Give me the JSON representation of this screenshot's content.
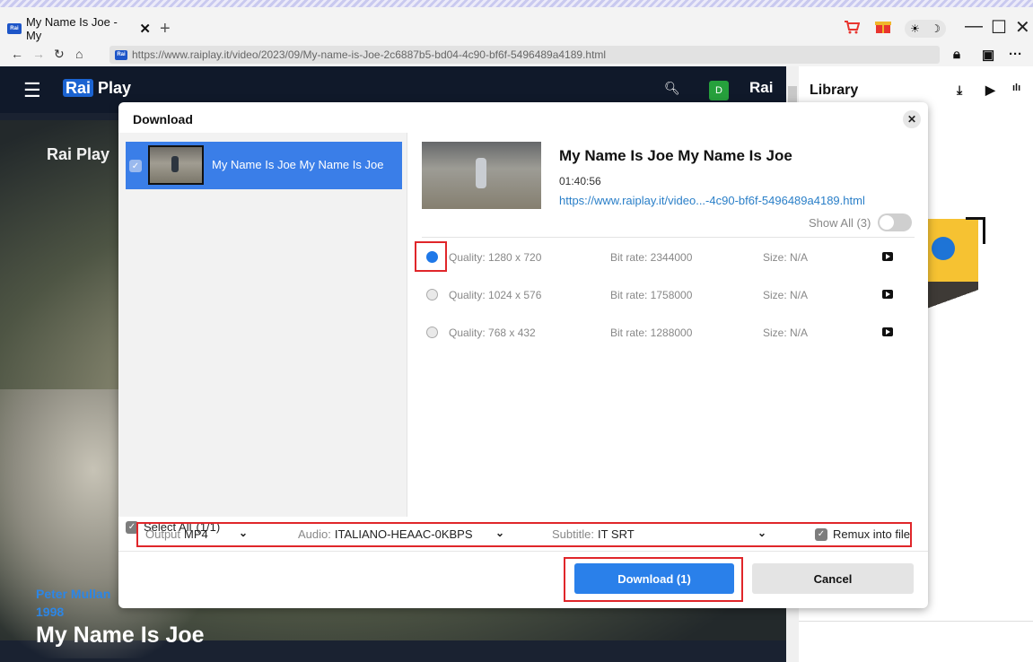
{
  "browser": {
    "tab_title": "My Name Is Joe - My",
    "tab_close": "✕",
    "new_tab": "+",
    "url": "https://www.raiplay.it/video/2023/09/My-name-is-Joe-2c6887b5-bd04-4c90-bf6f-5496489a4189.html",
    "favicon_text": "Rai"
  },
  "site": {
    "logo_rai": "Rai",
    "logo_play": "Play",
    "avatar_letter": "D",
    "rai_logo": "Rai",
    "watermark": "Rai Play",
    "credits_line1": "Peter Mullan",
    "credits_line2": "1998",
    "movie_title": "My Name Is Joe"
  },
  "library": {
    "title": "Library"
  },
  "dialog": {
    "title": "Download",
    "list_item_label": "My Name Is Joe My Name Is Joe",
    "select_all_label": "Select All",
    "select_all_count": "(1/1)",
    "video_title": "My Name Is Joe My Name Is Joe",
    "duration": "01:40:56",
    "video_url": "https://www.raiplay.it/video...-4c90-bf6f-5496489a4189.html",
    "show_all_label": "Show All (3)",
    "qualities": [
      {
        "quality": "Quality: 1280 x 720",
        "bitrate": "Bit rate: 2344000",
        "size": "Size: N/A",
        "selected": true
      },
      {
        "quality": "Quality: 1024 x 576",
        "bitrate": "Bit rate: 1758000",
        "size": "Size: N/A",
        "selected": false
      },
      {
        "quality": "Quality: 768 x 432",
        "bitrate": "Bit rate: 1288000",
        "size": "Size: N/A",
        "selected": false
      }
    ],
    "output_label": "Output",
    "output_value": "MP4",
    "audio_label": "Audio:",
    "audio_value": "ITALIANO-HEAAC-0KBPS",
    "subtitle_label": "Subtitle:",
    "subtitle_value": "IT SRT",
    "remux_label": "Remux into file",
    "download_button": "Download (1)",
    "cancel_button": "Cancel"
  },
  "colors": {
    "accent": "#2a80ea",
    "highlight": "#e0262a",
    "selected_item": "#3a7ee8"
  }
}
